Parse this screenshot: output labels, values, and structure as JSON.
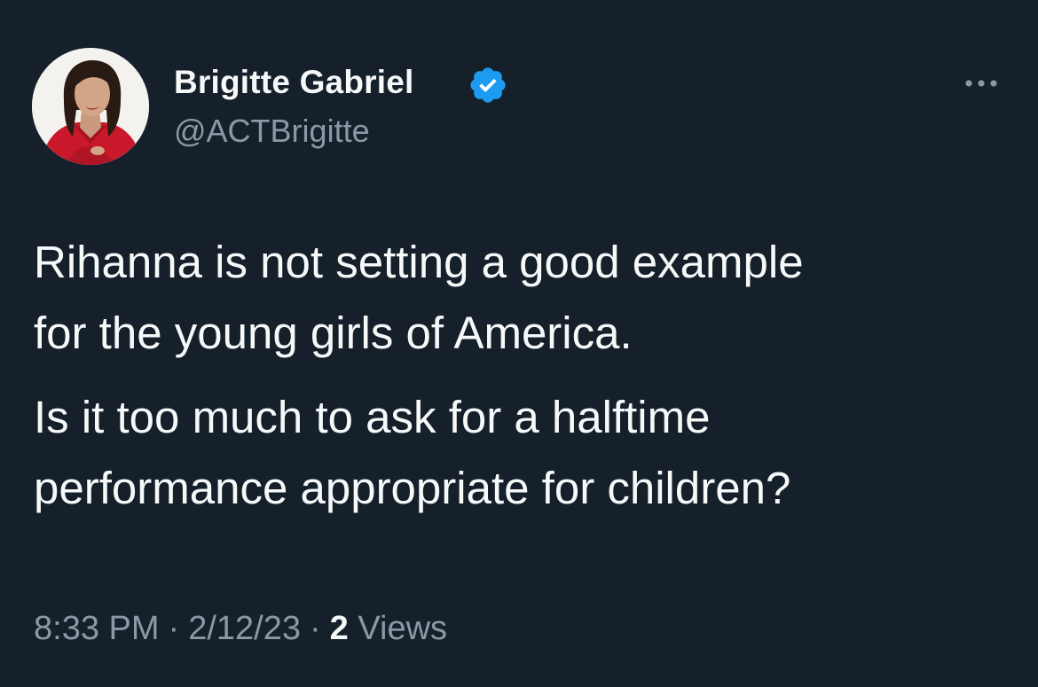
{
  "tweet": {
    "author": {
      "name": "Brigitte Gabriel",
      "handle": "@ACTBrigitte",
      "verified": true,
      "avatar_icon": "profile-photo"
    },
    "more_icon": "ellipsis-icon",
    "text": {
      "line1": "Rihanna is not setting a good example",
      "line2": "for the young girls of America.",
      "line3": "Is it too much to ask for a halftime",
      "line4": "performance appropriate for children?"
    },
    "meta": {
      "time": "8:33 PM",
      "separator": "·",
      "date": "2/12/23",
      "views_count": "2",
      "views_label": "Views"
    }
  },
  "colors": {
    "background": "#15202b",
    "text_primary": "#f7f9f9",
    "text_secondary": "#8b98a5",
    "verified_blue": "#1d9bf0"
  }
}
